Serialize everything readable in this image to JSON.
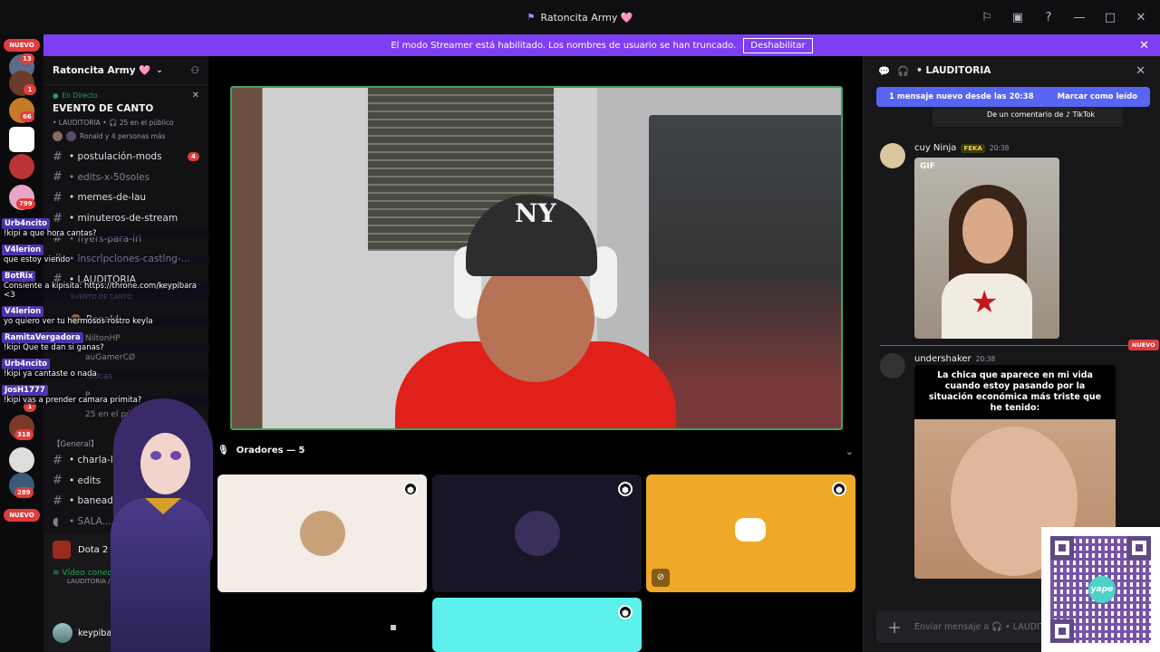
{
  "window": {
    "title": "Ratoncita Army 🩷"
  },
  "banner": {
    "text": "El modo Streamer está habilitado. Los nombres de usuario se han truncado.",
    "button": "Deshabilitar"
  },
  "guilds": {
    "nuevo_top": "NUEVO",
    "nuevo_bottom": "NUEVO",
    "badges": [
      "13",
      "1",
      "66",
      "799",
      "1",
      "318",
      "289"
    ]
  },
  "server": {
    "name": "Ratoncita Army 🩷",
    "event": {
      "status": "En Directo",
      "title": "EVENTO DE CANTO",
      "meta": "• LAUDITORIA • 🎧 25 en el público",
      "people": "Ronald y 4 personas más"
    },
    "channels": [
      {
        "name": "• postulación-mods",
        "badge": "4",
        "dim": false
      },
      {
        "name": "• edits-x-50soles",
        "badge": "",
        "dim": true
      },
      {
        "name": "• memes-de-lau",
        "badge": "",
        "dim": false
      },
      {
        "name": "• minuteros-de-stream",
        "badge": "",
        "dim": false
      },
      {
        "name": "• flyers-para-irl",
        "badge": "",
        "dim": true
      },
      {
        "name": "• inscripciones-casting-...",
        "badge": "",
        "dim": false
      },
      {
        "name": "• LAUDITORIA",
        "badge": "",
        "dim": false
      }
    ],
    "voice_members": {
      "event_sub": "EVENTO DE CANTO",
      "members": [
        "Ronald",
        "NiltonHP",
        "auGamerCØ",
        "radcas",
        "P...",
        "25 en el públi..."
      ],
      "counts": [
        "30",
        "50"
      ]
    },
    "category": "【General】",
    "channels_2": [
      "• charla-l...",
      "• edits",
      "• baneados",
      "• SALA..."
    ]
  },
  "voice_status": {
    "dota": "Dota 2",
    "connected": "Vídeo conectado",
    "where": "LAUDITORIA / R..."
  },
  "user": {
    "name": "keypibara"
  },
  "overlay_chat": [
    {
      "name": "Urb4ncito",
      "text": "!kipi a que hora cantas?"
    },
    {
      "name": "V4lerion",
      "text": "que estoy viendo"
    },
    {
      "name": "BotRix",
      "text": "Consiente a kipisita: https://throne.com/keypibara <3"
    },
    {
      "name": "V4lerion",
      "text": "yo quiero ver tu hermosos rostro keyla"
    },
    {
      "name": "RamitaVergadora",
      "text": "!kipi Que te dan si ganas?"
    },
    {
      "name": "Urb4ncito",
      "text": "!kipi ya cantaste o nada"
    },
    {
      "name": "JosH1777",
      "text": "!kipi vas a prender camara primita?"
    }
  ],
  "stage": {
    "speakers_header": "Oradores — 5",
    "tiles": [
      {
        "color": "#f3ece7",
        "avatar": "#c9a27a"
      },
      {
        "color": "#161626",
        "avatar": "#3a2f5a"
      },
      {
        "color": "#f0a828",
        "avatar": "discord-logo"
      },
      {
        "color": "#5ef0ec",
        "avatar": "#2a2a5a"
      }
    ]
  },
  "chat": {
    "header": "• LAUDITORIA",
    "new_messages": "1 mensaje nuevo desde las 20:38",
    "mark_read": "Marcar como leído",
    "tiktok": "De un comentario de ♪ TikTok",
    "messages": [
      {
        "name": "cuy Ninja",
        "tag": "FEKA",
        "time": "20:38",
        "attachment": "GIF"
      },
      {
        "name": "undershaker",
        "time": "20:38",
        "meme_text": "La chica que aparece en mi vida cuando estoy pasando por la situación económica más triste que he tenido:"
      }
    ],
    "nuevo": "NUEVO",
    "input_placeholder": "Enviar mensaje a 🎧 • LAUDITORIA"
  },
  "qr": {
    "brand": "yape"
  }
}
